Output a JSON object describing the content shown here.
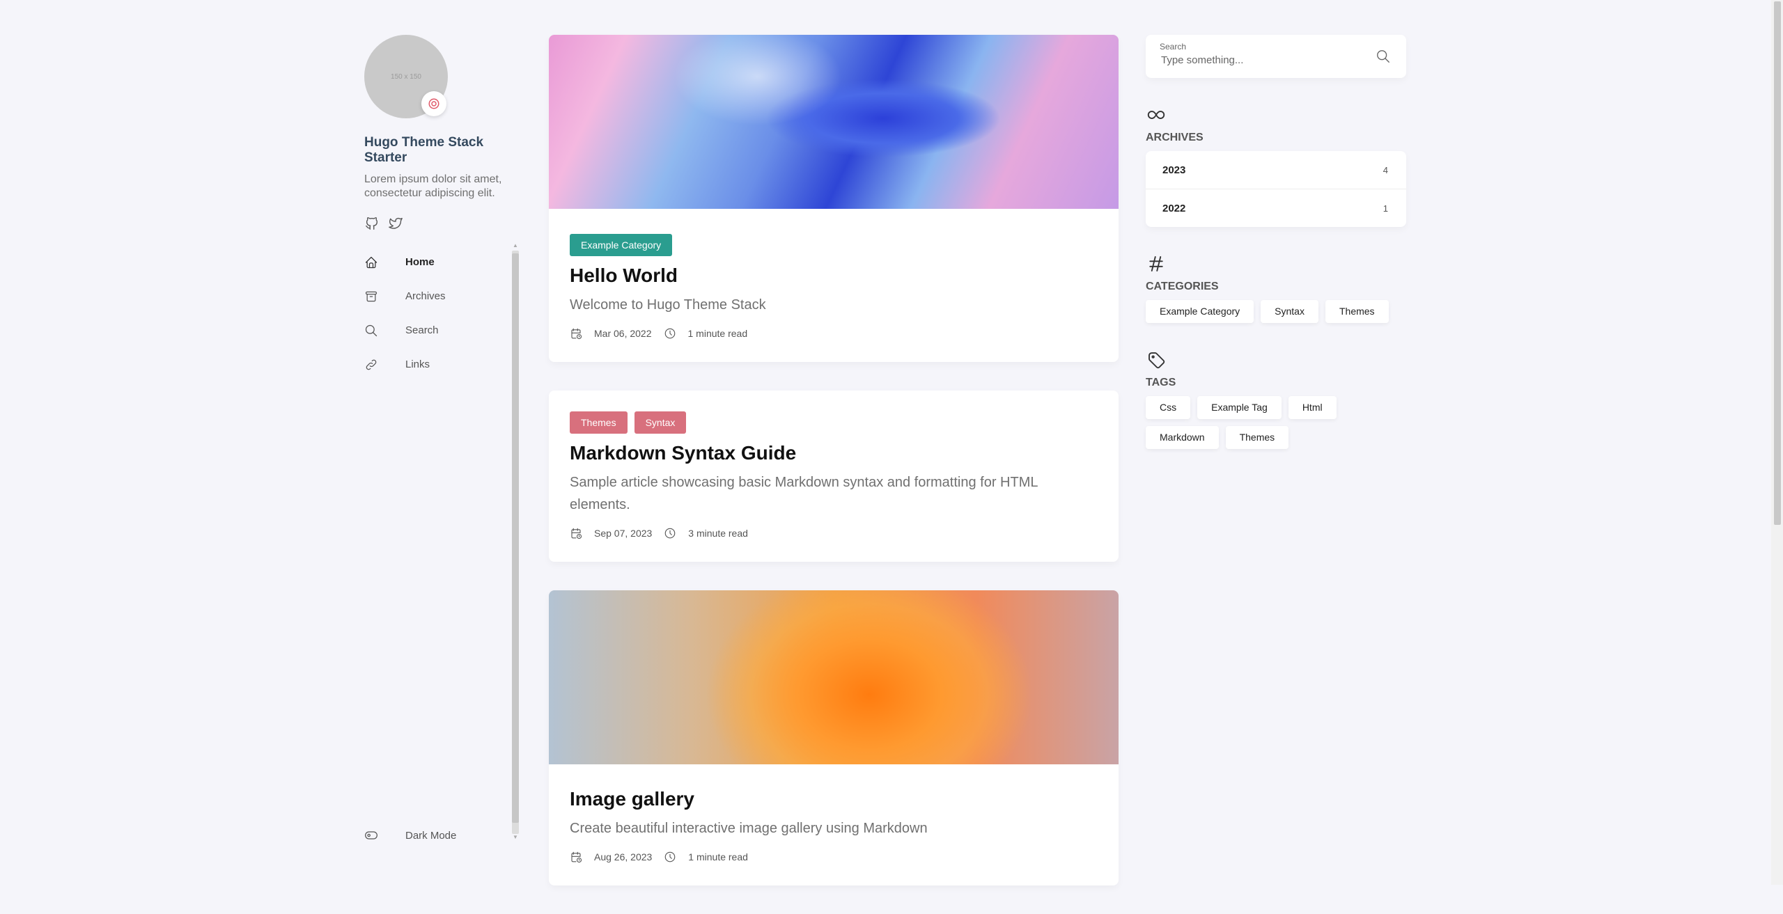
{
  "sidebar": {
    "avatar_placeholder": "150 x 150",
    "site_name": "Hugo Theme Stack Starter",
    "site_description": "Lorem ipsum dolor sit amet, consectetur adipiscing elit.",
    "menu": [
      {
        "label": "Home",
        "icon": "home-icon",
        "active": true
      },
      {
        "label": "Archives",
        "icon": "archive-icon",
        "active": false
      },
      {
        "label": "Search",
        "icon": "search-icon",
        "active": false
      },
      {
        "label": "Links",
        "icon": "link-icon",
        "active": false
      }
    ],
    "dark_mode_label": "Dark Mode"
  },
  "posts": [
    {
      "categories": [
        {
          "label": "Example Category",
          "color": "#2a9d8f"
        }
      ],
      "title": "Hello World",
      "subtitle": "Welcome to Hugo Theme Stack",
      "date": "Mar 06, 2022",
      "reading_time": "1 minute read"
    },
    {
      "categories": [
        {
          "label": "Themes",
          "color": "#d8707d"
        },
        {
          "label": "Syntax",
          "color": "#d8707d"
        }
      ],
      "title": "Markdown Syntax Guide",
      "subtitle": "Sample article showcasing basic Markdown syntax and formatting for HTML elements.",
      "date": "Sep 07, 2023",
      "reading_time": "3 minute read"
    },
    {
      "categories": [],
      "title": "Image gallery",
      "subtitle": "Create beautiful interactive image gallery using Markdown",
      "date": "Aug 26, 2023",
      "reading_time": "1 minute read"
    }
  ],
  "search": {
    "label": "Search",
    "placeholder": "Type something..."
  },
  "archives": {
    "title": "ARCHIVES",
    "items": [
      {
        "year": "2023",
        "count": "4"
      },
      {
        "year": "2022",
        "count": "1"
      }
    ]
  },
  "categories": {
    "title": "CATEGORIES",
    "items": [
      "Example Category",
      "Syntax",
      "Themes"
    ]
  },
  "tags": {
    "title": "TAGS",
    "items": [
      "Css",
      "Example Tag",
      "Html",
      "Markdown",
      "Themes"
    ]
  }
}
